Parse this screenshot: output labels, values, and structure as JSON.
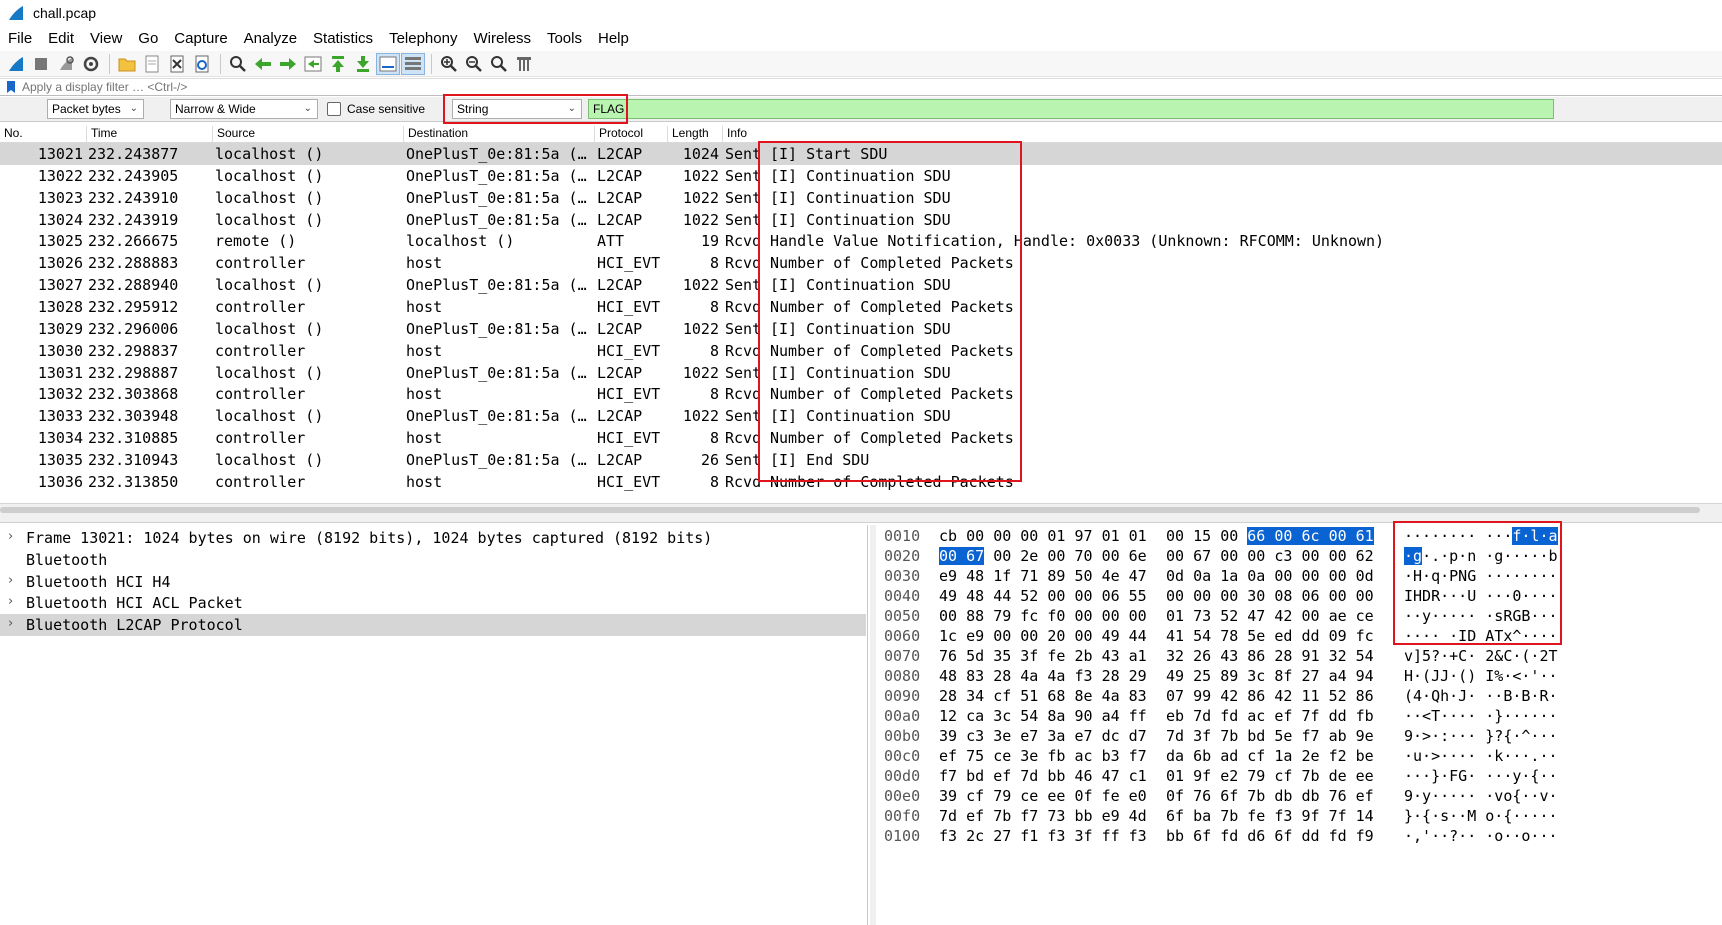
{
  "window": {
    "title": "chall.pcap"
  },
  "menu": [
    "File",
    "Edit",
    "View",
    "Go",
    "Capture",
    "Analyze",
    "Statistics",
    "Telephony",
    "Wireless",
    "Tools",
    "Help"
  ],
  "toolbar_icons": [
    "shark-fin-start-icon",
    "stop-icon",
    "restart-icon",
    "options-gear-icon",
    "open-folder-icon",
    "save-file-icon",
    "close-file-icon",
    "reload-icon",
    "find-packet-icon",
    "go-back-icon",
    "go-forward-icon",
    "go-to-packet-icon",
    "first-packet-icon",
    "last-packet-icon",
    "autoscroll-icon",
    "colorize-icon",
    "zoom-in-icon",
    "zoom-out-icon",
    "normal-size-icon",
    "resize-columns-icon"
  ],
  "display_filter": {
    "placeholder": "Apply a display filter … <Ctrl-/>"
  },
  "find_bar": {
    "search_in": "Packet bytes",
    "char_width": "Narrow & Wide",
    "case_sensitive_label": "Case sensitive",
    "search_type": "String",
    "search_value": "FLAG"
  },
  "packet_list": {
    "columns": [
      "No.",
      "Time",
      "Source",
      "Destination",
      "Protocol",
      "Length",
      "Info"
    ],
    "rows": [
      {
        "no": "13021",
        "time": "232.243877",
        "src": "localhost ()",
        "dst": "OnePlusT_0e:81:5a (…",
        "proto": "L2CAP",
        "len": "1024",
        "dir": "Sent",
        "info": "[I] Start SDU",
        "selected": true
      },
      {
        "no": "13022",
        "time": "232.243905",
        "src": "localhost ()",
        "dst": "OnePlusT_0e:81:5a (…",
        "proto": "L2CAP",
        "len": "1022",
        "dir": "Sent",
        "info": "[I] Continuation SDU"
      },
      {
        "no": "13023",
        "time": "232.243910",
        "src": "localhost ()",
        "dst": "OnePlusT_0e:81:5a (…",
        "proto": "L2CAP",
        "len": "1022",
        "dir": "Sent",
        "info": "[I] Continuation SDU"
      },
      {
        "no": "13024",
        "time": "232.243919",
        "src": "localhost ()",
        "dst": "OnePlusT_0e:81:5a (…",
        "proto": "L2CAP",
        "len": "1022",
        "dir": "Sent",
        "info": "[I] Continuation SDU"
      },
      {
        "no": "13025",
        "time": "232.266675",
        "src": "remote ()",
        "dst": "localhost ()",
        "proto": "ATT",
        "len": "19",
        "dir": "Rcvd",
        "info": "Handle Value Notification, Handle: 0x0033 (Unknown: RFCOMM: Unknown)"
      },
      {
        "no": "13026",
        "time": "232.288883",
        "src": "controller",
        "dst": "host",
        "proto": "HCI_EVT",
        "len": "8",
        "dir": "Rcvd",
        "info": "Number of Completed Packets"
      },
      {
        "no": "13027",
        "time": "232.288940",
        "src": "localhost ()",
        "dst": "OnePlusT_0e:81:5a (…",
        "proto": "L2CAP",
        "len": "1022",
        "dir": "Sent",
        "info": "[I] Continuation SDU"
      },
      {
        "no": "13028",
        "time": "232.295912",
        "src": "controller",
        "dst": "host",
        "proto": "HCI_EVT",
        "len": "8",
        "dir": "Rcvd",
        "info": "Number of Completed Packets"
      },
      {
        "no": "13029",
        "time": "232.296006",
        "src": "localhost ()",
        "dst": "OnePlusT_0e:81:5a (…",
        "proto": "L2CAP",
        "len": "1022",
        "dir": "Sent",
        "info": "[I] Continuation SDU"
      },
      {
        "no": "13030",
        "time": "232.298837",
        "src": "controller",
        "dst": "host",
        "proto": "HCI_EVT",
        "len": "8",
        "dir": "Rcvd",
        "info": "Number of Completed Packets"
      },
      {
        "no": "13031",
        "time": "232.298887",
        "src": "localhost ()",
        "dst": "OnePlusT_0e:81:5a (…",
        "proto": "L2CAP",
        "len": "1022",
        "dir": "Sent",
        "info": "[I] Continuation SDU"
      },
      {
        "no": "13032",
        "time": "232.303868",
        "src": "controller",
        "dst": "host",
        "proto": "HCI_EVT",
        "len": "8",
        "dir": "Rcvd",
        "info": "Number of Completed Packets"
      },
      {
        "no": "13033",
        "time": "232.303948",
        "src": "localhost ()",
        "dst": "OnePlusT_0e:81:5a (…",
        "proto": "L2CAP",
        "len": "1022",
        "dir": "Sent",
        "info": "[I] Continuation SDU"
      },
      {
        "no": "13034",
        "time": "232.310885",
        "src": "controller",
        "dst": "host",
        "proto": "HCI_EVT",
        "len": "8",
        "dir": "Rcvd",
        "info": "Number of Completed Packets"
      },
      {
        "no": "13035",
        "time": "232.310943",
        "src": "localhost ()",
        "dst": "OnePlusT_0e:81:5a (…",
        "proto": "L2CAP",
        "len": "26",
        "dir": "Sent",
        "info": "[I] End SDU"
      },
      {
        "no": "13036",
        "time": "232.313850",
        "src": "controller",
        "dst": "host",
        "proto": "HCI_EVT",
        "len": "8",
        "dir": "Rcvd",
        "info": "Number of Completed Packets"
      }
    ]
  },
  "details": [
    {
      "text": "Frame 13021: 1024 bytes on wire (8192 bits), 1024 bytes captured (8192 bits)",
      "expandable": true
    },
    {
      "text": "Bluetooth",
      "expandable": false
    },
    {
      "text": "Bluetooth HCI H4",
      "expandable": true
    },
    {
      "text": "Bluetooth HCI ACL Packet",
      "expandable": true
    },
    {
      "text": "Bluetooth L2CAP Protocol",
      "expandable": true,
      "selected": true
    }
  ],
  "bytes": [
    {
      "off": "0010",
      "hex1": "cb 00 00 00 01 97 01 01",
      "hex2": "00 15 00 66 00 6c 00 61",
      "ascii": "········ ···f·l·a"
    },
    {
      "off": "0020",
      "hex1": "00 67 00 2e 00 70 00 6e",
      "hex2": "00 67 00 00 c3 00 00 62",
      "ascii": "·g·.·p·n ·g·····b"
    },
    {
      "off": "0030",
      "hex1": "e9 48 1f 71 89 50 4e 47",
      "hex2": "0d 0a 1a 0a 00 00 00 0d",
      "ascii": "·H·q·PNG ········"
    },
    {
      "off": "0040",
      "hex1": "49 48 44 52 00 00 06 55",
      "hex2": "00 00 00 30 08 06 00 00",
      "ascii": "IHDR···U ···0····"
    },
    {
      "off": "0050",
      "hex1": "00 88 79 fc f0 00 00 00",
      "hex2": "01 73 52 47 42 00 ae ce",
      "ascii": "··y····· ·sRGB···"
    },
    {
      "off": "0060",
      "hex1": "1c e9 00 00 20 00 49 44",
      "hex2": "41 54 78 5e ed dd 09 fc",
      "ascii": "···· ·ID ATx^····"
    },
    {
      "off": "0070",
      "hex1": "76 5d 35 3f fe 2b 43 a1",
      "hex2": "32 26 43 86 28 91 32 54",
      "ascii": "v]5?·+C· 2&C·(·2T"
    },
    {
      "off": "0080",
      "hex1": "48 83 28 4a 4a f3 28 29",
      "hex2": "49 25 89 3c 8f 27 a4 94",
      "ascii": "H·(JJ·() I%·<·'··"
    },
    {
      "off": "0090",
      "hex1": "28 34 cf 51 68 8e 4a 83",
      "hex2": "07 99 42 86 42 11 52 86",
      "ascii": "(4·Qh·J· ··B·B·R·"
    },
    {
      "off": "00a0",
      "hex1": "12 ca 3c 54 8a 90 a4 ff",
      "hex2": "eb 7d fd ac ef 7f dd fb",
      "ascii": "··<T···· ·}······"
    },
    {
      "off": "00b0",
      "hex1": "39 c3 3e e7 3a e7 dc d7",
      "hex2": "7d 3f 7b bd 5e f7 ab 9e",
      "ascii": "9·>·:··· }?{·^···"
    },
    {
      "off": "00c0",
      "hex1": "ef 75 ce 3e fb ac b3 f7",
      "hex2": "da 6b ad cf 1a 2e f2 be",
      "ascii": "·u·>···· ·k···.··"
    },
    {
      "off": "00d0",
      "hex1": "f7 bd ef 7d bb 46 47 c1",
      "hex2": "01 9f e2 79 cf 7b de ee",
      "ascii": "···}·FG· ···y·{··"
    },
    {
      "off": "00e0",
      "hex1": "39 cf 79 ce ee 0f fe e0",
      "hex2": "0f 76 6f 7b db db 76 ef",
      "ascii": "9·y····· ·vo{··v·"
    },
    {
      "off": "00f0",
      "hex1": "7d ef 7b f7 73 bb e9 4d",
      "hex2": "6f ba 7b fe f3 9f 7f 14",
      "ascii": "}·{·s··M o·{·····"
    },
    {
      "off": "0100",
      "hex1": "f3 2c 27 f1 f3 3f ff f3",
      "hex2": "bb 6f fd d6 6f dd fd f9",
      "ascii": "·,'··?·· ·o··o···"
    }
  ],
  "colors": {
    "selection": "#d6d6d6",
    "byte_highlight": "#0a63d2",
    "find_match_bg": "#b9f5b0",
    "annotation_red": "#e0141c"
  }
}
